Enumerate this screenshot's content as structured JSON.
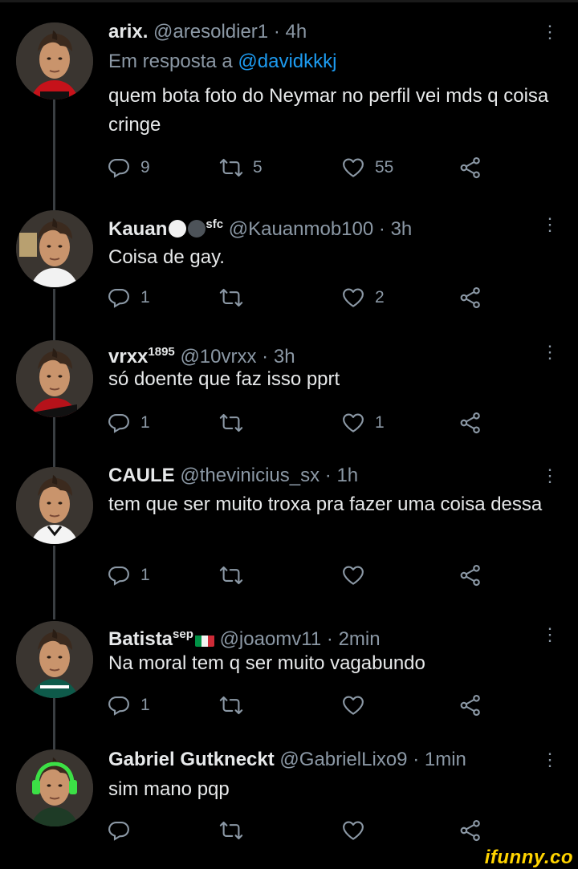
{
  "tweets": [
    {
      "name": "arix.",
      "handle": "@aresoldier1",
      "time": "4h",
      "reply_prefix": "Em resposta a",
      "reply_handle": "@davidkkkj",
      "text": "quem bota foto do Neymar no perfil vei mds q coisa cringe",
      "replies": "9",
      "retweets": "5",
      "likes": "55"
    },
    {
      "name": "Kauan",
      "name_suffix": "sfc",
      "handle": "@Kauanmob100",
      "time": "3h",
      "text": "Coisa de gay.",
      "replies": "1",
      "retweets": "",
      "likes": "2"
    },
    {
      "name": "vrxx",
      "name_suffix": "1895",
      "handle": "@10vrxx",
      "time": "3h",
      "text": "só doente que faz isso pprt",
      "replies": "1",
      "retweets": "",
      "likes": "1"
    },
    {
      "name": "CAULE",
      "handle": "@thevinicius_sx",
      "time": "1h",
      "text": "tem que ser muito troxa pra fazer uma coisa dessa",
      "replies": "1",
      "retweets": "",
      "likes": ""
    },
    {
      "name": "Batista",
      "name_suffix": "sep",
      "handle": "@joaomv11",
      "time": "2min",
      "text": "Na moral tem q ser muito vagabundo",
      "replies": "1",
      "retweets": "",
      "likes": ""
    },
    {
      "name": "Gabriel Gutkneckt",
      "handle": "@GabrielLixo9",
      "time": "1min",
      "text": "sim mano pqp",
      "replies": "",
      "retweets": "",
      "likes": ""
    }
  ],
  "separator": "·",
  "watermark": "ifunny.co",
  "colors": {
    "background": "#000000",
    "text": "#e7e9ea",
    "muted": "#8b98a5",
    "link": "#1d9bf0",
    "watermark": "#ffd400"
  },
  "icons": [
    "reply-icon",
    "retweet-icon",
    "like-icon",
    "share-icon",
    "more-icon"
  ]
}
